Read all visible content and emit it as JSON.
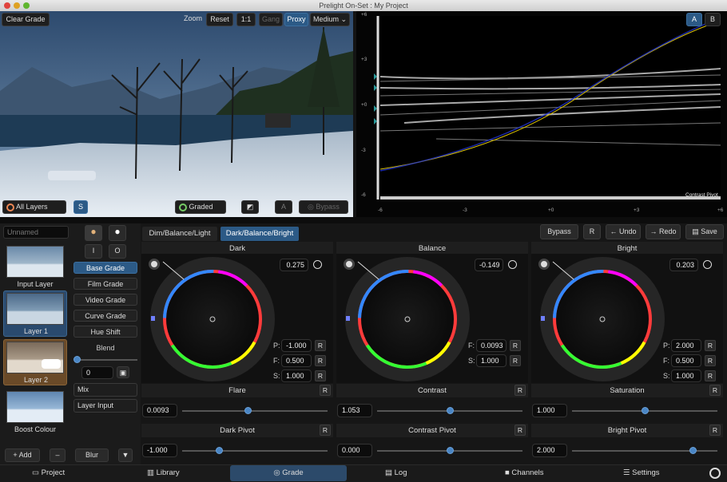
{
  "window": {
    "title": "Prelight On-Set : My Project"
  },
  "viewer": {
    "clear_grade": "Clear Grade",
    "zoom": "Zoom",
    "reset": "Reset",
    "one_to_one": "1:1",
    "gang": "Gang",
    "proxy": "Proxy",
    "quality": "Medium",
    "layers": "All Layers",
    "solo": "S",
    "view_mode": "Graded",
    "a_label": "A",
    "bypass": "Bypass"
  },
  "scope": {
    "a": "A",
    "b": "B",
    "y_ticks": [
      "+6",
      "+3",
      "+0",
      "-3",
      "-6"
    ],
    "x_ticks": [
      "-6",
      "-3",
      "+0",
      "+3",
      "+6"
    ],
    "label": "Contrast Pivot"
  },
  "layers": {
    "name_placeholder": "Unnamed",
    "items": [
      {
        "label": "Input Layer"
      },
      {
        "label": "Layer 1"
      },
      {
        "label": "Layer 2"
      },
      {
        "label": "Boost Colour"
      }
    ],
    "add": "+ Add",
    "remove": "–",
    "blur": "Blur",
    "more": "▼"
  },
  "tools": {
    "i": "I",
    "o": "O",
    "tabs": [
      "Base Grade",
      "Film Grade",
      "Video Grade",
      "Curve Grade",
      "Hue Shift"
    ],
    "blend": "Blend",
    "blend_value": "0",
    "mix": "Mix",
    "layer_input": "Layer Input"
  },
  "grade": {
    "tabs": [
      "Dim/Balance/Light",
      "Dark/Balance/Bright"
    ],
    "bypass": "Bypass",
    "r": "R",
    "undo": "Undo",
    "redo": "Redo",
    "save": "Save",
    "wheels": [
      {
        "title": "Dark",
        "value": "0.275",
        "params": [
          {
            "k": "P:",
            "v": "-1.000"
          },
          {
            "k": "F:",
            "v": "0.500"
          },
          {
            "k": "S:",
            "v": "1.000"
          }
        ]
      },
      {
        "title": "Balance",
        "value": "-0.149",
        "params": [
          {
            "k": "F:",
            "v": "0.0093"
          },
          {
            "k": "S:",
            "v": "1.000"
          }
        ]
      },
      {
        "title": "Bright",
        "value": "0.203",
        "params": [
          {
            "k": "P:",
            "v": "2.000"
          },
          {
            "k": "F:",
            "v": "0.500"
          },
          {
            "k": "S:",
            "v": "1.000"
          }
        ]
      }
    ],
    "sliders": [
      {
        "title": "Flare",
        "value": "0.0093",
        "level": 0.45
      },
      {
        "title": "Contrast",
        "value": "1.053",
        "level": 0.5
      },
      {
        "title": "Saturation",
        "value": "1.000",
        "level": 0.5
      },
      {
        "title": "Dark Pivot",
        "value": "-1.000",
        "level": 0.25
      },
      {
        "title": "Contrast Pivot",
        "value": "0.000",
        "level": 0.5
      },
      {
        "title": "Bright Pivot",
        "value": "2.000",
        "level": 0.83
      }
    ]
  },
  "nav": {
    "project": "Project",
    "library": "Library",
    "grade": "Grade",
    "log": "Log",
    "channels": "Channels",
    "settings": "Settings"
  }
}
